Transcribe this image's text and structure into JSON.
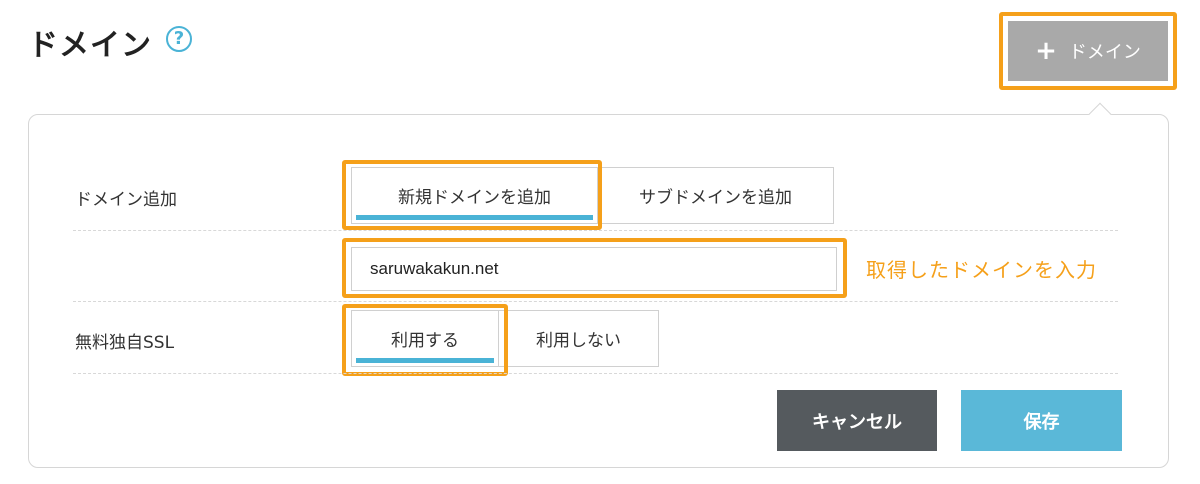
{
  "header": {
    "title": "ドメイン",
    "help_icon": "?",
    "add_button_label": "ドメイン",
    "add_button_icon": "+"
  },
  "form": {
    "domain_add": {
      "label": "ドメイン追加",
      "options": [
        "新規ドメインを追加",
        "サブドメインを追加"
      ],
      "selected": "新規ドメインを追加"
    },
    "domain_input": {
      "value": "saruwakakun.net"
    },
    "ssl": {
      "label": "無料独自SSL",
      "options": [
        "利用する",
        "利用しない"
      ],
      "selected": "利用する"
    }
  },
  "annotation": "取得したドメインを入力",
  "buttons": {
    "cancel": "キャンセル",
    "save": "保存"
  },
  "colors": {
    "highlight": "#f5a01a",
    "accent": "#4ab3d6",
    "save": "#5ab8d8",
    "cancel": "#555a5e",
    "add_button": "#a9a9a9"
  }
}
